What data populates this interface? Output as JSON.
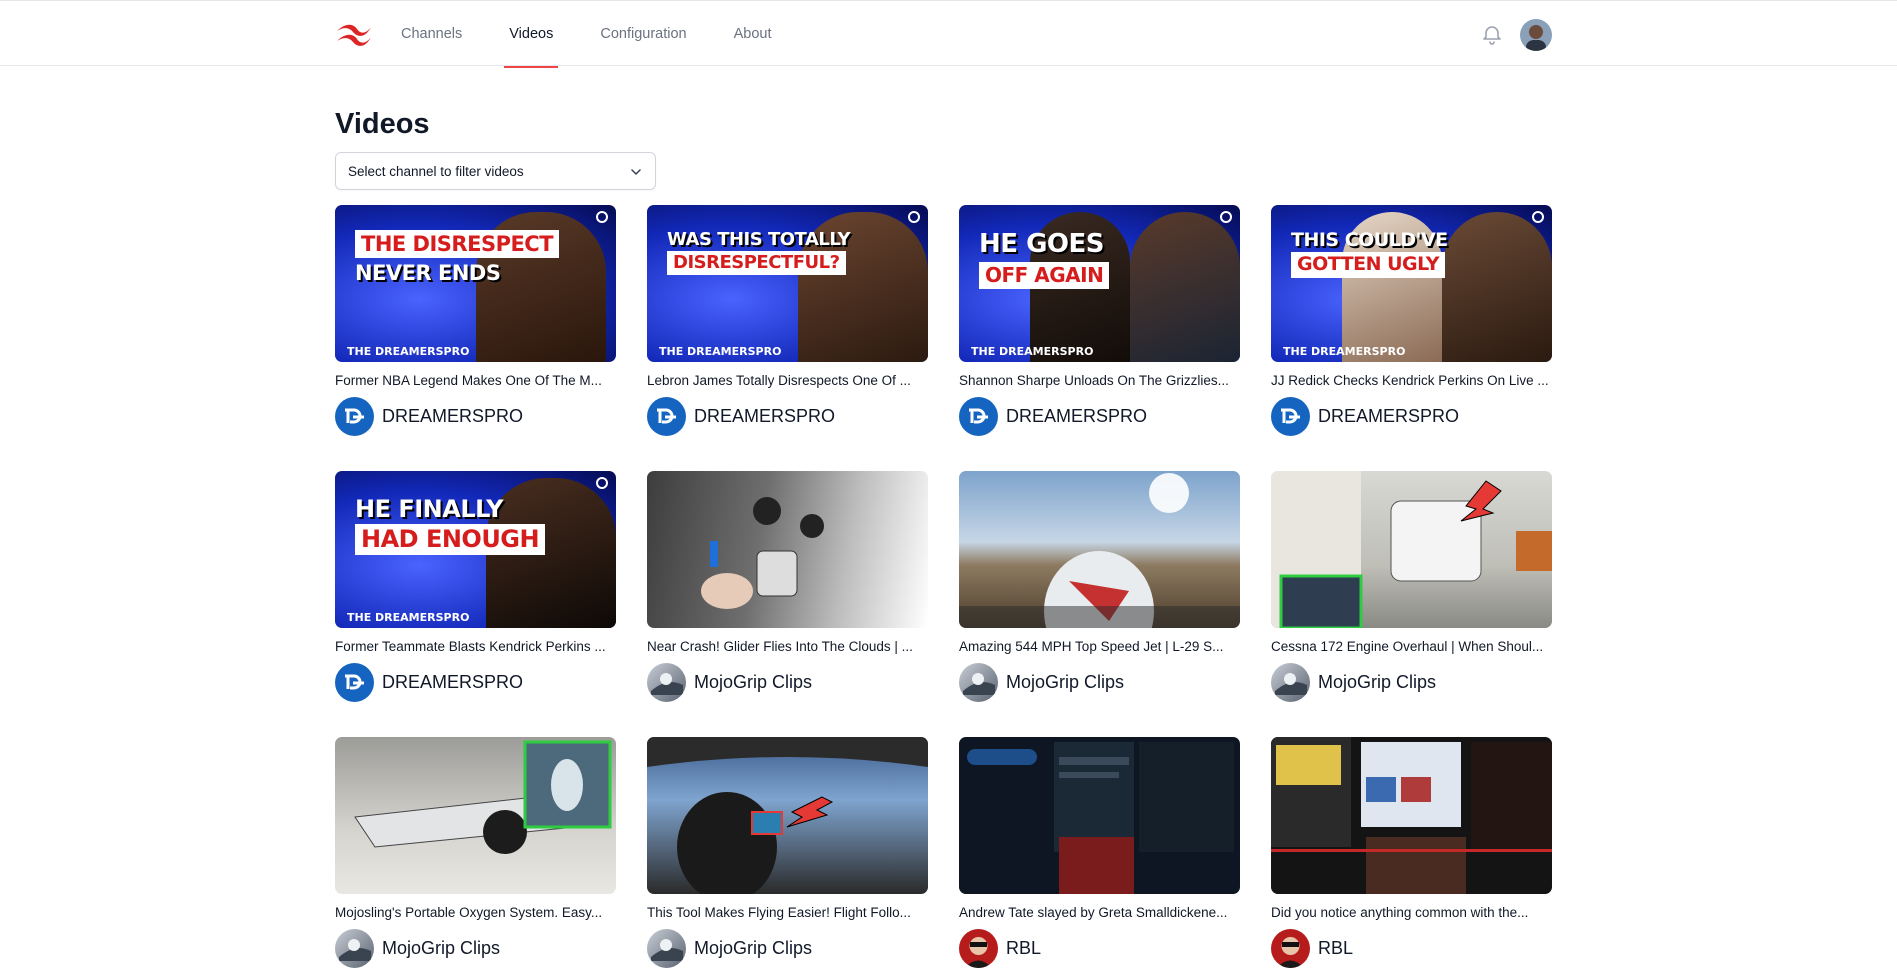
{
  "nav": {
    "items": [
      {
        "label": "Channels",
        "active": false
      },
      {
        "label": "Videos",
        "active": true
      },
      {
        "label": "Configuration",
        "active": false
      },
      {
        "label": "About",
        "active": false
      }
    ],
    "accent_color": "#ef4444"
  },
  "page": {
    "title": "Videos",
    "filter_placeholder": "Select channel to filter videos"
  },
  "videos": [
    {
      "title": "Former NBA Legend Makes One Of The M...",
      "channel": "DREAMERSPRO",
      "thumb_text": [
        "THE DISRESPECT",
        "NEVER ENDS"
      ],
      "thumb_brand": "THE DREAMERSPRO"
    },
    {
      "title": "Lebron James Totally Disrespects One Of ...",
      "channel": "DREAMERSPRO",
      "thumb_text": [
        "WAS THIS TOTALLY",
        "DISRESPECTFUL?"
      ],
      "thumb_brand": "THE DREAMERSPRO"
    },
    {
      "title": "Shannon Sharpe Unloads On The Grizzlies...",
      "channel": "DREAMERSPRO",
      "thumb_text": [
        "HE GOES",
        "OFF AGAIN"
      ],
      "thumb_brand": "THE DREAMERSPRO"
    },
    {
      "title": "JJ Redick Checks Kendrick Perkins On Live ...",
      "channel": "DREAMERSPRO",
      "thumb_text": [
        "THIS COULD'VE",
        "GOTTEN UGLY"
      ],
      "thumb_brand": "THE DREAMERSPRO"
    },
    {
      "title": "Former Teammate Blasts Kendrick Perkins ...",
      "channel": "DREAMERSPRO",
      "thumb_text": [
        "HE FINALLY",
        "HAD ENOUGH"
      ],
      "thumb_brand": "THE DREAMERSPRO"
    },
    {
      "title": "Near Crash! Glider Flies Into The Clouds | ...",
      "channel": "MojoGrip Clips"
    },
    {
      "title": "Amazing 544 MPH Top Speed Jet | L-29 S...",
      "channel": "MojoGrip Clips"
    },
    {
      "title": "Cessna 172 Engine Overhaul | When Shoul...",
      "channel": "MojoGrip Clips"
    },
    {
      "title": "Mojosling's Portable Oxygen System. Easy...",
      "channel": "MojoGrip Clips"
    },
    {
      "title": "This Tool Makes Flying Easier! Flight Follo...",
      "channel": "MojoGrip Clips"
    },
    {
      "title": "Andrew Tate slayed by Greta Smalldickene...",
      "channel": "RBL"
    },
    {
      "title": "Did you notice anything common with the...",
      "channel": "RBL"
    }
  ]
}
